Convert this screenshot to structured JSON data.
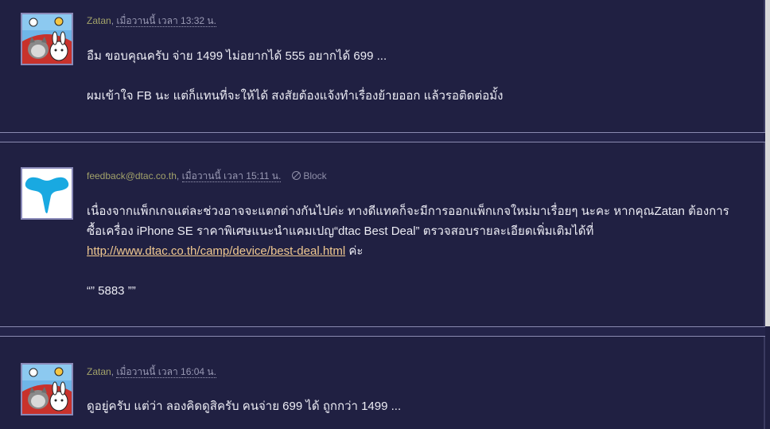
{
  "comments": [
    {
      "author": "Zatan",
      "date": "เมื่อวานนี้ เวลา 13:32 น.",
      "paragraphs": [
        "อืม ขอบคุณครับ จ่าย 1499 ไม่อยากได้ 555 อยากได้ 699 ...",
        "ผมเข้าใจ FB นะ  แต่ก็แทนที่จะให้ได้ สงสัยต้องแจ้งทำเรื่องย้ายออก แล้วรอติดต่อมั้ง"
      ]
    },
    {
      "author": "feedback@dtac.co.th",
      "date": "เมื่อวานนี้ เวลา 15:11 น.",
      "block_label": "Block",
      "para1_text": "เนื่องจากแพ็กเกจแต่ละช่วงอาจจะแตกต่างกันไปค่ะ ทางดีแทคก็จะมีการออกแพ็กเกจใหม่มาเรื่อยๆ นะคะ   หากคุณZatan ต้องการซื้อเครื่อง  iPhone SE  ราคาพิเศษแนะนำแคมเปญ“dtac Best Deal”   ตรวจสอบรายละเอียดเพิ่มเติมได้ที่ ",
      "link_text": "http://www.dtac.co.th/camp/device/best-deal.html",
      "para1_suffix": " ค่ะ",
      "signature": "“” 5883 ””"
    },
    {
      "author": "Zatan",
      "date": "เมื่อวานนี้ เวลา 16:04 น.",
      "paragraphs": [
        "ดูอยู่ครับ แต่ว่า ลองคิดดูสิครับ คนจ่าย 699 ได้ ถูกกว่า 1499 ..."
      ]
    }
  ],
  "colors": {
    "background": "#202042",
    "author": "#a2a26a",
    "link": "#f0c890",
    "dtac_logo": "#19a9e1"
  },
  "icons": [
    "block-icon",
    "dtac-logo",
    "cat-avatar"
  ]
}
